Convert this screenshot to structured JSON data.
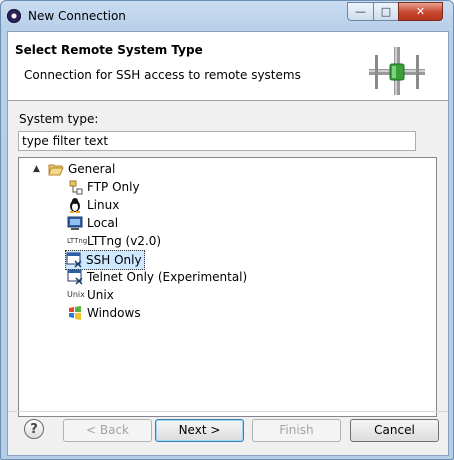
{
  "window": {
    "title": "New Connection",
    "minimize": "—",
    "maximize": "□",
    "close": "✕"
  },
  "header": {
    "title": "Select Remote System Type",
    "description": "Connection for SSH access to remote systems"
  },
  "system_type": {
    "label": "System type:",
    "filter_value": "type filter text"
  },
  "tree": {
    "group": {
      "label": "General",
      "icon": "folder-open-icon",
      "expander": "▲"
    },
    "items": [
      {
        "label": "FTP Only",
        "icon": "ftp-icon"
      },
      {
        "label": "Linux",
        "icon": "linux-penguin-icon"
      },
      {
        "label": "Local",
        "icon": "local-computer-icon"
      },
      {
        "label": "LTTng (v2.0)",
        "icon": "lttng-icon",
        "icon_text": "LTTng"
      },
      {
        "label": "SSH Only",
        "icon": "ssh-icon",
        "selected": true
      },
      {
        "label": "Telnet Only (Experimental)",
        "icon": "telnet-icon"
      },
      {
        "label": "Unix",
        "icon": "unix-icon",
        "icon_text": "Unix"
      },
      {
        "label": "Windows",
        "icon": "windows-icon"
      }
    ]
  },
  "buttons": {
    "help": "?",
    "back": "< Back",
    "next": "Next >",
    "finish": "Finish",
    "cancel": "Cancel"
  },
  "colors": {
    "selection": "#cde8ff",
    "header_bg": "#ffffff",
    "dialog_bg": "#f0f0f0"
  }
}
